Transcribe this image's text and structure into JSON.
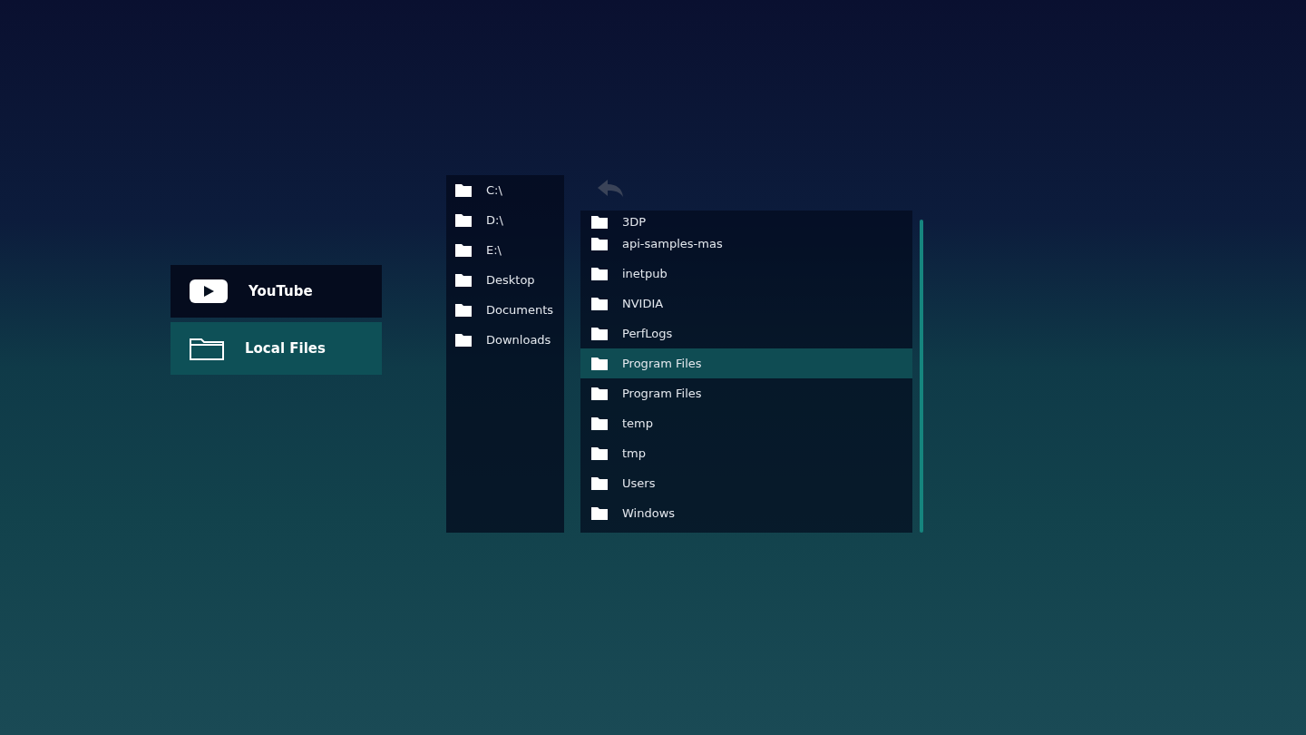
{
  "menu": [
    {
      "label": "YouTube",
      "kind": "youtube",
      "selected": false
    },
    {
      "label": "Local Files",
      "kind": "folder",
      "selected": true
    }
  ],
  "drives": [
    {
      "label": "C:\\"
    },
    {
      "label": "D:\\"
    },
    {
      "label": "E:\\"
    },
    {
      "label": "Desktop"
    },
    {
      "label": "Documents"
    },
    {
      "label": "Downloads"
    }
  ],
  "files": [
    {
      "label": "3DP",
      "selected": false
    },
    {
      "label": "api-samples-mas",
      "selected": false
    },
    {
      "label": "inetpub",
      "selected": false
    },
    {
      "label": "NVIDIA",
      "selected": false
    },
    {
      "label": "PerfLogs",
      "selected": false
    },
    {
      "label": "Program Files",
      "selected": true
    },
    {
      "label": "Program Files",
      "selected": false
    },
    {
      "label": "temp",
      "selected": false
    },
    {
      "label": "tmp",
      "selected": false
    },
    {
      "label": "Users",
      "selected": false
    },
    {
      "label": "Windows",
      "selected": false
    }
  ]
}
